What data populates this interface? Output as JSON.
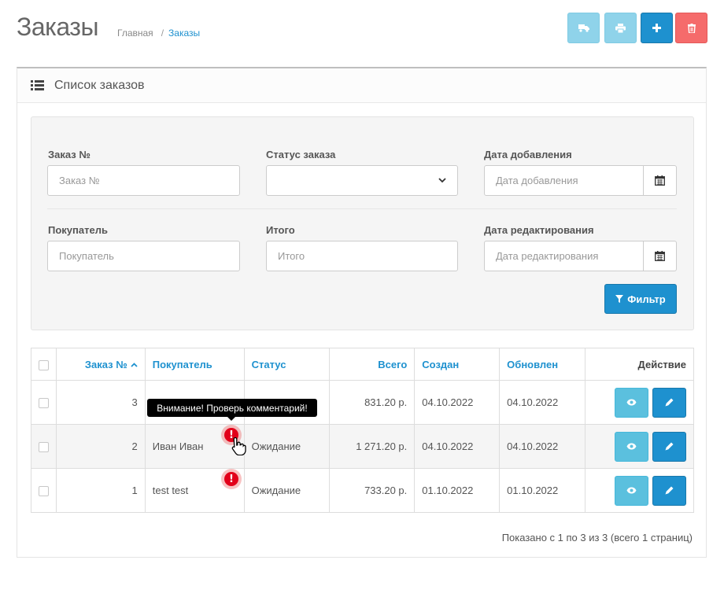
{
  "header": {
    "title": "Заказы",
    "breadcrumb": [
      {
        "label": "Главная"
      },
      {
        "label": "Заказы"
      }
    ],
    "buttons": [
      {
        "name": "ship",
        "icon": "truck-icon"
      },
      {
        "name": "print",
        "icon": "print-icon"
      },
      {
        "name": "add",
        "icon": "plus-icon"
      },
      {
        "name": "delete",
        "icon": "trash-icon"
      }
    ]
  },
  "panel": {
    "title": "Список заказов",
    "icon": "list-icon"
  },
  "filter": {
    "order_id": {
      "label": "Заказ №",
      "placeholder": "Заказ №",
      "value": ""
    },
    "order_status": {
      "label": "Статус заказа",
      "value": ""
    },
    "date_added": {
      "label": "Дата добавления",
      "placeholder": "Дата добавления",
      "value": ""
    },
    "customer": {
      "label": "Покупатель",
      "placeholder": "Покупатель",
      "value": ""
    },
    "total": {
      "label": "Итого",
      "placeholder": "Итого",
      "value": ""
    },
    "date_modified": {
      "label": "Дата редактирования",
      "placeholder": "Дата редактирования",
      "value": ""
    },
    "button_label": "Фильтр"
  },
  "table": {
    "columns": {
      "order_id": "Заказ №",
      "customer": "Покупатель",
      "status": "Статус",
      "total": "Всего",
      "created": "Создан",
      "updated": "Обновлен",
      "action": "Действие"
    },
    "rows": [
      {
        "order_id": "3",
        "customer": "",
        "status": "",
        "total": "831.20 р.",
        "created": "04.10.2022",
        "updated": "04.10.2022"
      },
      {
        "order_id": "2",
        "customer": "Иван Иван",
        "status": "Ожидание",
        "total": "1 271.20 р.",
        "created": "04.10.2022",
        "updated": "04.10.2022",
        "warning": true
      },
      {
        "order_id": "1",
        "customer": "test test",
        "status": "Ожидание",
        "total": "733.20 р.",
        "created": "01.10.2022",
        "updated": "01.10.2022",
        "warning": true
      }
    ]
  },
  "tooltip": "Внимание! Проверь комментарий!",
  "warning_glyph": "!",
  "pagination_text": "Показано с 1 по 3 из 3 (всего 1 страниц)",
  "colors": {
    "primary": "#1e91cf",
    "info": "#5bc0de",
    "danger": "#f56b6b",
    "warning_badge": "#e2001a"
  }
}
